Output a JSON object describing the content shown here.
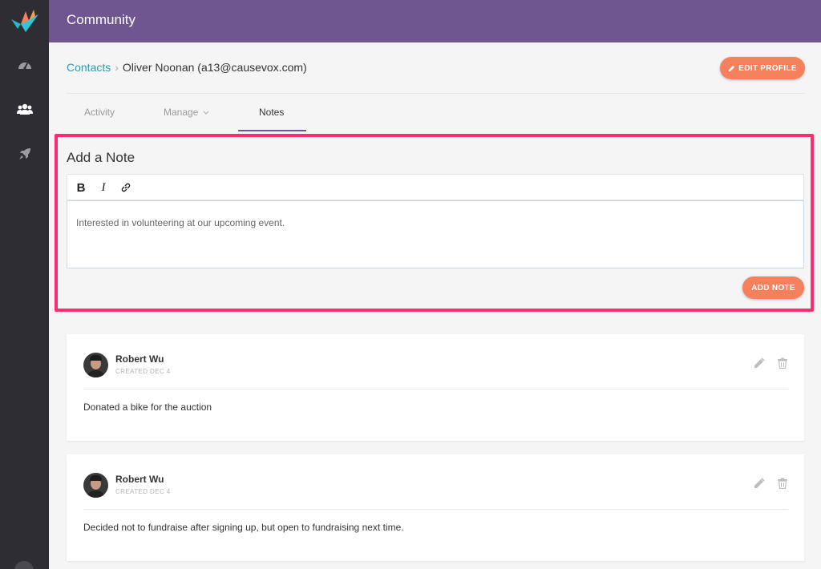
{
  "topbar": {
    "title": "Community"
  },
  "sidebar": {
    "icons": [
      "logo-bird",
      "dashboard-icon",
      "community-icon",
      "rocket-icon"
    ],
    "accent": "#2e2d33"
  },
  "breadcrumb": {
    "link": "Contacts",
    "separator": "›",
    "current": "Oliver Noonan (a13@causevox.com)"
  },
  "edit_profile": {
    "label": "EDIT PROFILE"
  },
  "tabs": [
    {
      "label": "Activity"
    },
    {
      "label": "Manage"
    },
    {
      "label": "Notes",
      "active": true
    }
  ],
  "add_note": {
    "heading": "Add a Note",
    "toolbar": {
      "bold": "B",
      "italic": "I"
    },
    "body": "Interested in volunteering at our upcoming event.",
    "submit_label": "ADD NOTE"
  },
  "notes": [
    {
      "author": "Robert Wu",
      "meta": "CREATED DEC 4",
      "text": "Donated a bike for the auction"
    },
    {
      "author": "Robert Wu",
      "meta": "CREATED DEC 4",
      "text": "Decided not to fundraise after signing up, but open to fundraising next time."
    }
  ],
  "colors": {
    "brand_purple": "#6f5690",
    "accent_orange": "#f4815b",
    "link_teal": "#2f9ab3",
    "highlight_pink": "#ff2d6f"
  }
}
